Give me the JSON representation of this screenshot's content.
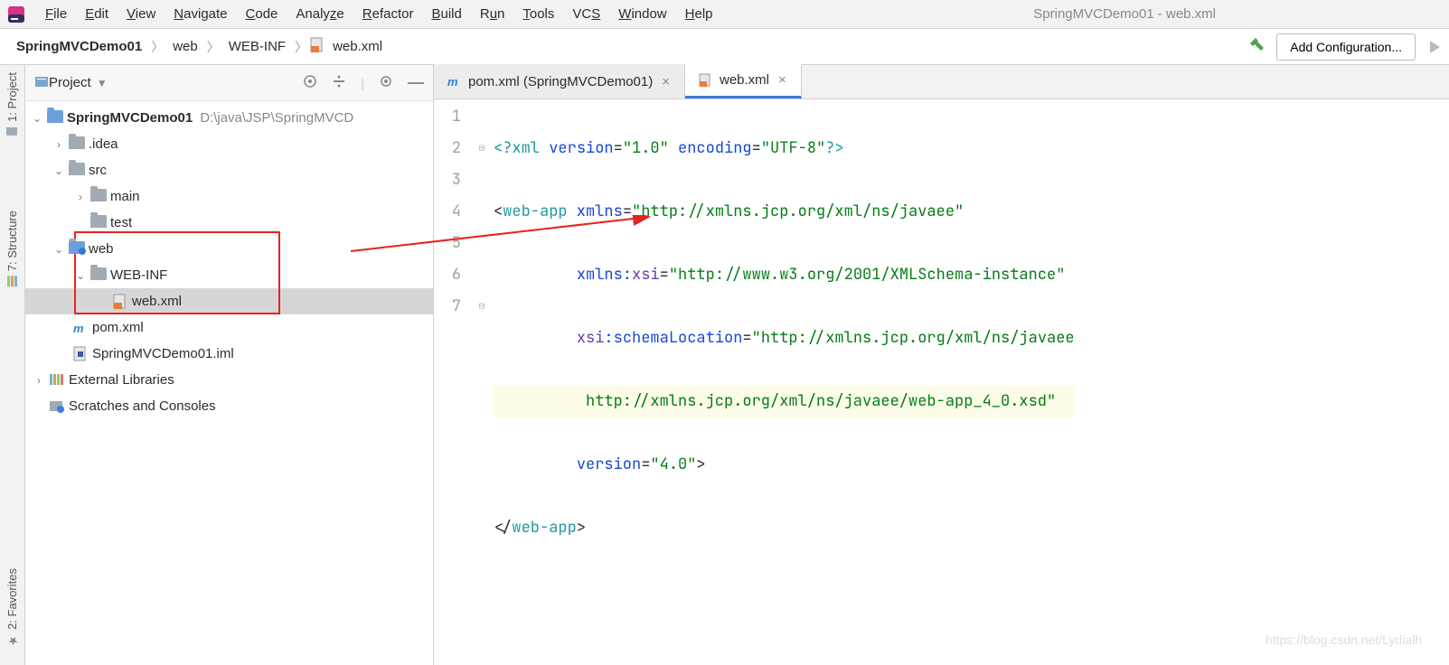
{
  "window_title": "SpringMVCDemo01 - web.xml",
  "menu": [
    "File",
    "Edit",
    "View",
    "Navigate",
    "Code",
    "Analyze",
    "Refactor",
    "Build",
    "Run",
    "Tools",
    "VCS",
    "Window",
    "Help"
  ],
  "menu_ul": [
    "F",
    "E",
    "V",
    "N",
    "C",
    "",
    "R",
    "B",
    "u",
    "T",
    "S",
    "W",
    "H"
  ],
  "breadcrumb": {
    "root": "SpringMVCDemo01",
    "p1": "web",
    "p2": "WEB-INF",
    "p3": "web.xml"
  },
  "config_btn": "Add Configuration...",
  "sidebar": {
    "title": "Project"
  },
  "strip": {
    "project": "1: Project",
    "structure": "7: Structure",
    "favorites": "2: Favorites"
  },
  "tree": {
    "root": "SpringMVCDemo01",
    "root_path": "D:\\java\\JSP\\SpringMVCD",
    "idea": ".idea",
    "src": "src",
    "main": "main",
    "test": "test",
    "web": "web",
    "webinf": "WEB-INF",
    "webxml": "web.xml",
    "pom": "pom.xml",
    "iml": "SpringMVCDemo01.iml",
    "ext": "External Libraries",
    "scratch": "Scratches and Consoles"
  },
  "tabs": {
    "t1": "pom.xml (SpringMVCDemo01)",
    "t2": "web.xml"
  },
  "code": {
    "l1a": "<?",
    "l1b": "xml",
    "l1c": " version",
    "l1d": "=",
    "l1e": "\"1.0\"",
    "l1f": " encoding",
    "l1g": "=",
    "l1h": "\"UTF-8\"",
    "l1i": "?>",
    "l2a": "<",
    "l2b": "web-app",
    "l2c": " xmlns",
    "l2d": "=",
    "l2e": "\"http://xmlns.jcp.org/xml/ns/javaee\"",
    "l3a": "         ",
    "l3b": "xmlns:",
    "l3c": "xsi",
    "l3d": "=",
    "l3e": "\"http://www.w3.org/2001/XMLSchema-instance\"",
    "l4a": "         ",
    "l4b": "xsi",
    "l4c": ":schemaLocation",
    "l4d": "=",
    "l4e": "\"http://xmlns.jcp.org/xml/ns/javaee",
    "l5a": "          http://xmlns.jcp.org/xml/ns/javaee/web-app_4_0.xsd\"",
    "l6a": "         ",
    "l6b": "version",
    "l6c": "=",
    "l6d": "\"4.0\"",
    "l6e": ">",
    "l7a": "</",
    "l7b": "web-app",
    "l7c": ">"
  },
  "watermark": "https://blog.csdn.net/Lydialh"
}
